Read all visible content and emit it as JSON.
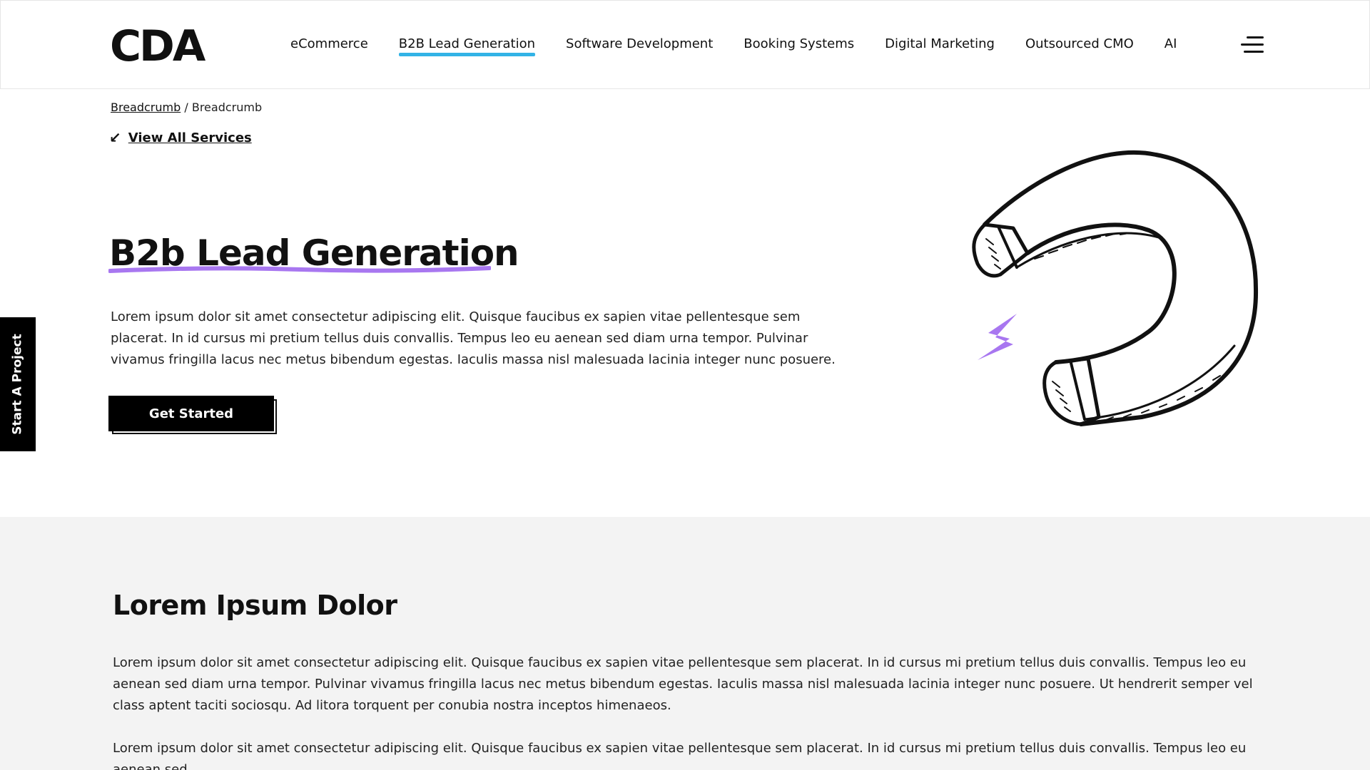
{
  "header": {
    "logo": "CDA",
    "nav": [
      {
        "label": "eCommerce"
      },
      {
        "label": "B2B Lead Generation",
        "active": true
      },
      {
        "label": "Software Development"
      },
      {
        "label": "Booking Systems"
      },
      {
        "label": "Digital Marketing"
      },
      {
        "label": "Outsourced CMO"
      },
      {
        "label": "AI"
      }
    ],
    "menu_icon": "hamburger-menu-icon"
  },
  "breadcrumb": {
    "link": "Breadcrumb",
    "separator": "/",
    "current": "Breadcrumb"
  },
  "view_all": {
    "icon": "arrow-down-left-icon",
    "label": "View All Services"
  },
  "hero": {
    "title": "B2b Lead Generation",
    "text": "Lorem ipsum dolor sit amet consectetur adipiscing elit. Quisque faucibus ex sapien vitae pellentesque sem placerat. In id cursus mi pretium tellus duis convallis. Tempus leo eu aenean sed diam urna tempor. Pulvinar vivamus fringilla lacus nec metus bibendum egestas. Iaculis massa nisl malesuada lacinia integer nunc posuere.",
    "cta": "Get Started",
    "illustration": "magnet-icon",
    "accent_color": "#a877f0"
  },
  "side_tab": {
    "label": "Start A Project"
  },
  "section2": {
    "heading": "Lorem Ipsum Dolor",
    "p1": "Lorem ipsum dolor sit amet consectetur adipiscing elit. Quisque faucibus ex sapien vitae pellentesque sem placerat. In id cursus mi pretium tellus duis convallis. Tempus leo eu aenean sed diam urna tempor. Pulvinar vivamus fringilla lacus nec metus bibendum egestas. Iaculis massa nisl malesuada lacinia integer nunc posuere. Ut hendrerit semper vel class aptent taciti sociosqu. Ad litora torquent per conubia nostra inceptos himenaeos.",
    "p2": "Lorem ipsum dolor sit amet consectetur adipiscing elit. Quisque faucibus ex sapien vitae pellentesque sem placerat. In id cursus mi pretium tellus duis convallis. Tempus leo eu aenean sed",
    "background": "#f3f3f3"
  },
  "colors": {
    "nav_active_underline": "#32b3e6",
    "title_underline": "#a877f0",
    "primary": "#000000"
  }
}
